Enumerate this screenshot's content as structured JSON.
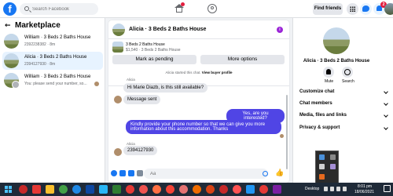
{
  "topbar": {
    "logo": "f",
    "search_placeholder": "Search Facebook",
    "find_friends": "Find friends",
    "notification_count": "2"
  },
  "sidebar": {
    "title": "Marketplace",
    "conversations": [
      {
        "title": "William · 3 Beds 2 Baths House",
        "subtitle": "2392238382 · 8m"
      },
      {
        "title": "Alicia · 3 Beds 2 Baths House",
        "subtitle": "2394127930 · 8m"
      },
      {
        "title": "William · 3 Beds 2 Baths House",
        "subtitle": "You: please send your number, so..."
      }
    ]
  },
  "chat": {
    "title": "Alicia · 3 Beds 2 Baths House",
    "listing_title": "3 Beds 2 Baths House",
    "listing_price": "$1,540 · 3 Beds 2 Baths House",
    "mark_pending": "Mark as pending",
    "more_options": "More options",
    "system_note_prefix": "Alicia started this chat.",
    "system_note_link": "View buyer profile",
    "sender_name": "Alicia",
    "messages": {
      "in1": "Hi Marie Diazb, is this still available?",
      "in2": "Message sent",
      "out1": "Yes, are you interested?",
      "out2": "Kindly provide your phone number so that we can give you more information about this accommodation. Thanks",
      "in3": "2394127930"
    },
    "composer_placeholder": "Aa"
  },
  "right_panel": {
    "title": "Alicia · 3 Beds 2 Baths House",
    "mute_label": "Mute",
    "search_label": "Search",
    "sections": [
      "Customize chat",
      "Chat members",
      "Media, files and links",
      "Privacy & support"
    ]
  },
  "taskbar": {
    "desktop_label": "Desktop",
    "time": "8:01 pm",
    "date": "18/06/2021"
  },
  "colors": {
    "facebook_blue": "#1877f2",
    "outgoing_bubble": "#5045e5",
    "badge_red": "#e41e3f"
  }
}
